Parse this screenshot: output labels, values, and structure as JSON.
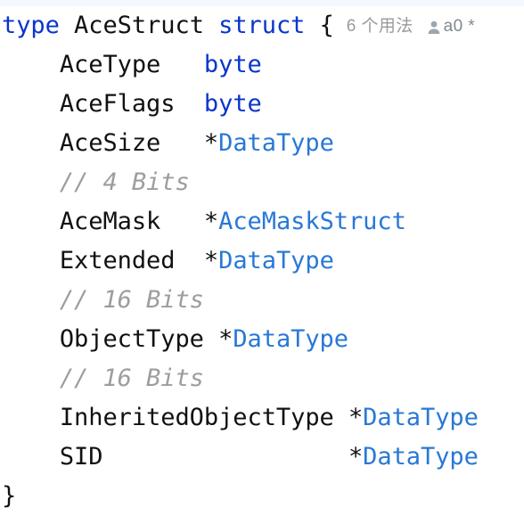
{
  "editor": {
    "language": "go",
    "background_color": "#ffffff",
    "keyword_color": "#0a35cc",
    "type_color": "#2878d6",
    "comment_color": "#9d9d9d",
    "text_color": "#111111",
    "codelens_color": "#9a9a9a"
  },
  "codelens": {
    "usages_label": "6 个用法",
    "author_icon": "person-icon",
    "author_label": "a0 *"
  },
  "code": {
    "lines": [
      {
        "id": "line-declaration",
        "kw1": "type",
        "space1": " ",
        "name": "AceStruct",
        "space2": " ",
        "kw2": "struct",
        "space3": " ",
        "brace": "{",
        "trailing_space": "  "
      },
      {
        "id": "line-acetype",
        "indent": "    ",
        "field": "AceType",
        "pad": "   ",
        "star": "",
        "type": "byte",
        "comment": ""
      },
      {
        "id": "line-aceflags",
        "indent": "    ",
        "field": "AceFlags",
        "pad": "  ",
        "star": "",
        "type": "byte",
        "comment": ""
      },
      {
        "id": "line-acesize",
        "indent": "    ",
        "field": "AceSize",
        "pad": "   ",
        "star": "*",
        "type": "DataType",
        "comment": ""
      },
      {
        "id": "line-comment-4bits",
        "indent": "    ",
        "comment": "// 4 Bits"
      },
      {
        "id": "line-acemask",
        "indent": "    ",
        "field": "AceMask",
        "pad": "   ",
        "star": "*",
        "type": "AceMaskStruct",
        "comment": ""
      },
      {
        "id": "line-extended",
        "indent": "    ",
        "field": "Extended",
        "pad": "  ",
        "star": "*",
        "type": "DataType",
        "comment": ""
      },
      {
        "id": "line-comment-16bits-a",
        "indent": "    ",
        "comment": "// 16 Bits"
      },
      {
        "id": "line-objecttype",
        "indent": "    ",
        "field": "ObjectType",
        "pad": " ",
        "star": "*",
        "type": "DataType",
        "comment": ""
      },
      {
        "id": "line-comment-16bits-b",
        "indent": "    ",
        "comment": "// 16 Bits"
      },
      {
        "id": "line-inheritedobjecttype",
        "indent": "    ",
        "field": "InheritedObjectType",
        "pad": " ",
        "star": "*",
        "type": "DataType",
        "comment": ""
      },
      {
        "id": "line-sid",
        "indent": "    ",
        "field": "SID",
        "pad": "                 ",
        "star": "*",
        "type": "DataType",
        "comment": ""
      },
      {
        "id": "line-close-brace",
        "brace": "}"
      }
    ]
  }
}
